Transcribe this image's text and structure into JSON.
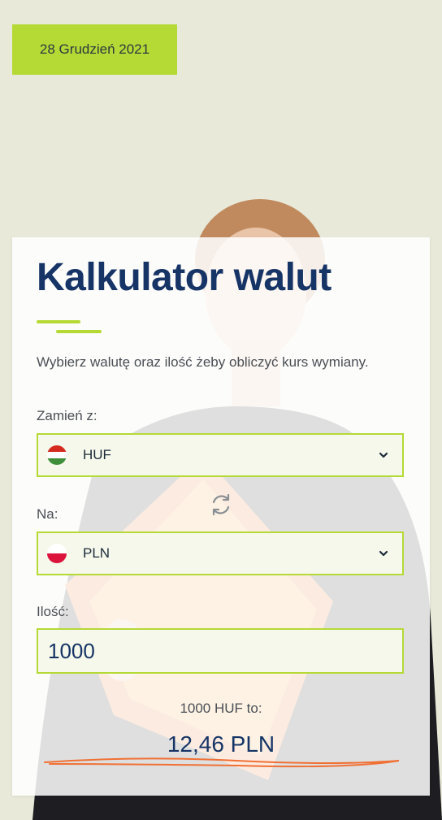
{
  "date_badge": "28 Grudzień 2021",
  "calculator": {
    "title": "Kalkulator walut",
    "subtitle": "Wybierz walutę oraz ilość żeby obliczyć kurs wymiany.",
    "from_label": "Zamień z:",
    "from_currency": "HUF",
    "to_label": "Na:",
    "to_currency": "PLN",
    "amount_label": "Ilość:",
    "amount_value": "1000",
    "result_label": "1000 HUF to:",
    "result_value": "12,46 PLN"
  },
  "colors": {
    "accent": "#b5d935",
    "title": "#163466",
    "scribble": "#f07034"
  },
  "icons": {
    "from_flag": "hungary-flag-icon",
    "to_flag": "poland-flag-icon",
    "swap": "swap-icon",
    "chevron": "chevron-down-icon"
  }
}
